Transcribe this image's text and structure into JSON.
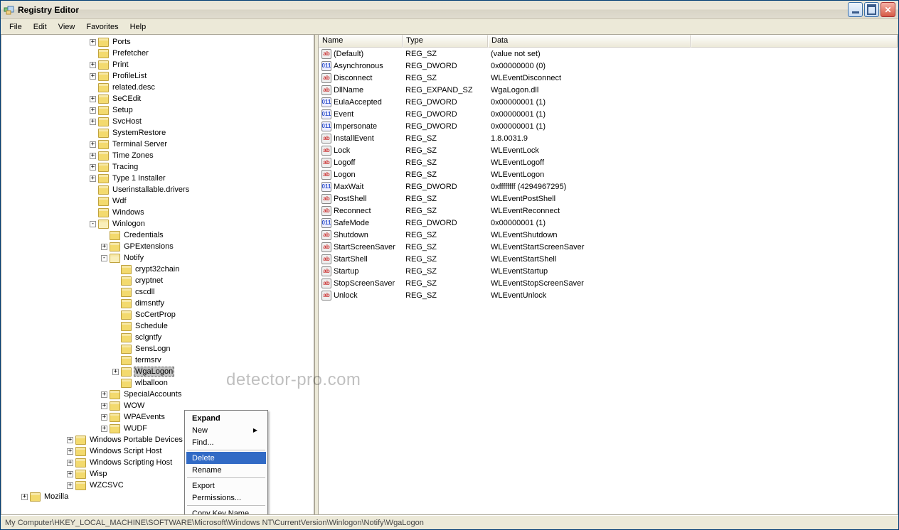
{
  "window": {
    "title": "Registry Editor"
  },
  "menubar": {
    "items": [
      "File",
      "Edit",
      "View",
      "Favorites",
      "Help"
    ]
  },
  "statusbar": {
    "path": "My Computer\\HKEY_LOCAL_MACHINE\\SOFTWARE\\Microsoft\\Windows NT\\CurrentVersion\\Winlogon\\Notify\\WgaLogon"
  },
  "watermark": "detector-pro.com",
  "columns": {
    "name": "Name",
    "type": "Type",
    "data": "Data"
  },
  "tree": {
    "lvl0": [
      {
        "exp": "+",
        "label": "Ports"
      },
      {
        "exp": "",
        "label": "Prefetcher"
      },
      {
        "exp": "+",
        "label": "Print"
      },
      {
        "exp": "+",
        "label": "ProfileList"
      },
      {
        "exp": "",
        "label": "related.desc"
      },
      {
        "exp": "+",
        "label": "SeCEdit"
      },
      {
        "exp": "+",
        "label": "Setup"
      },
      {
        "exp": "+",
        "label": "SvcHost"
      },
      {
        "exp": "",
        "label": "SystemRestore"
      },
      {
        "exp": "+",
        "label": "Terminal Server"
      },
      {
        "exp": "+",
        "label": "Time Zones"
      },
      {
        "exp": "+",
        "label": "Tracing"
      },
      {
        "exp": "+",
        "label": "Type 1 Installer"
      },
      {
        "exp": "",
        "label": "Userinstallable.drivers"
      },
      {
        "exp": "",
        "label": "Wdf"
      },
      {
        "exp": "",
        "label": "Windows"
      },
      {
        "exp": "-",
        "label": "Winlogon",
        "open": true
      }
    ],
    "winlogon_children": [
      {
        "exp": "",
        "label": "Credentials"
      },
      {
        "exp": "+",
        "label": "GPExtensions"
      },
      {
        "exp": "-",
        "label": "Notify",
        "open": true
      }
    ],
    "notify_children": [
      {
        "exp": "",
        "label": "crypt32chain"
      },
      {
        "exp": "",
        "label": "cryptnet"
      },
      {
        "exp": "",
        "label": "cscdll"
      },
      {
        "exp": "",
        "label": "dimsntfy"
      },
      {
        "exp": "",
        "label": "ScCertProp"
      },
      {
        "exp": "",
        "label": "Schedule"
      },
      {
        "exp": "",
        "label": "sclgntfy"
      },
      {
        "exp": "",
        "label": "SensLogn"
      },
      {
        "exp": "",
        "label": "termsrv"
      },
      {
        "exp": "+",
        "label": "WgaLogon",
        "selected": true
      },
      {
        "exp": "",
        "label": "wlballoon"
      }
    ],
    "winlogon_after": [
      {
        "exp": "+",
        "label": "SpecialAccounts"
      },
      {
        "exp": "+",
        "label": "WOW"
      },
      {
        "exp": "+",
        "label": "WPAEvents"
      },
      {
        "exp": "+",
        "label": "WUDF"
      }
    ],
    "after_lvl0": [
      {
        "exp": "+",
        "label": "Windows Portable Devices"
      },
      {
        "exp": "+",
        "label": "Windows Script Host"
      },
      {
        "exp": "+",
        "label": "Windows Scripting Host"
      },
      {
        "exp": "+",
        "label": "Wisp"
      },
      {
        "exp": "+",
        "label": "WZCSVC"
      }
    ],
    "mozilla": {
      "exp": "+",
      "label": "Mozilla"
    }
  },
  "values": [
    {
      "icon": "sz",
      "name": "(Default)",
      "type": "REG_SZ",
      "data": "(value not set)"
    },
    {
      "icon": "dw",
      "name": "Asynchronous",
      "type": "REG_DWORD",
      "data": "0x00000000 (0)"
    },
    {
      "icon": "sz",
      "name": "Disconnect",
      "type": "REG_SZ",
      "data": "WLEventDisconnect"
    },
    {
      "icon": "sz",
      "name": "DllName",
      "type": "REG_EXPAND_SZ",
      "data": "WgaLogon.dll"
    },
    {
      "icon": "dw",
      "name": "EulaAccepted",
      "type": "REG_DWORD",
      "data": "0x00000001 (1)"
    },
    {
      "icon": "dw",
      "name": "Event",
      "type": "REG_DWORD",
      "data": "0x00000001 (1)"
    },
    {
      "icon": "dw",
      "name": "Impersonate",
      "type": "REG_DWORD",
      "data": "0x00000001 (1)"
    },
    {
      "icon": "sz",
      "name": "InstallEvent",
      "type": "REG_SZ",
      "data": "1.8.0031.9"
    },
    {
      "icon": "sz",
      "name": "Lock",
      "type": "REG_SZ",
      "data": "WLEventLock"
    },
    {
      "icon": "sz",
      "name": "Logoff",
      "type": "REG_SZ",
      "data": "WLEventLogoff"
    },
    {
      "icon": "sz",
      "name": "Logon",
      "type": "REG_SZ",
      "data": "WLEventLogon"
    },
    {
      "icon": "dw",
      "name": "MaxWait",
      "type": "REG_DWORD",
      "data": "0xffffffff (4294967295)"
    },
    {
      "icon": "sz",
      "name": "PostShell",
      "type": "REG_SZ",
      "data": "WLEventPostShell"
    },
    {
      "icon": "sz",
      "name": "Reconnect",
      "type": "REG_SZ",
      "data": "WLEventReconnect"
    },
    {
      "icon": "dw",
      "name": "SafeMode",
      "type": "REG_DWORD",
      "data": "0x00000001 (1)"
    },
    {
      "icon": "sz",
      "name": "Shutdown",
      "type": "REG_SZ",
      "data": "WLEventShutdown"
    },
    {
      "icon": "sz",
      "name": "StartScreenSaver",
      "type": "REG_SZ",
      "data": "WLEventStartScreenSaver"
    },
    {
      "icon": "sz",
      "name": "StartShell",
      "type": "REG_SZ",
      "data": "WLEventStartShell"
    },
    {
      "icon": "sz",
      "name": "Startup",
      "type": "REG_SZ",
      "data": "WLEventStartup"
    },
    {
      "icon": "sz",
      "name": "StopScreenSaver",
      "type": "REG_SZ",
      "data": "WLEventStopScreenSaver"
    },
    {
      "icon": "sz",
      "name": "Unlock",
      "type": "REG_SZ",
      "data": "WLEventUnlock"
    }
  ],
  "context_menu": {
    "items": [
      "Expand",
      "New",
      "Find...",
      "__sep__",
      "Delete",
      "Rename",
      "__sep__",
      "Export",
      "Permissions...",
      "__sep__",
      "Copy Key Name"
    ],
    "highlighted": "Delete",
    "bold": "Expand",
    "submenu_arrow": "New"
  }
}
